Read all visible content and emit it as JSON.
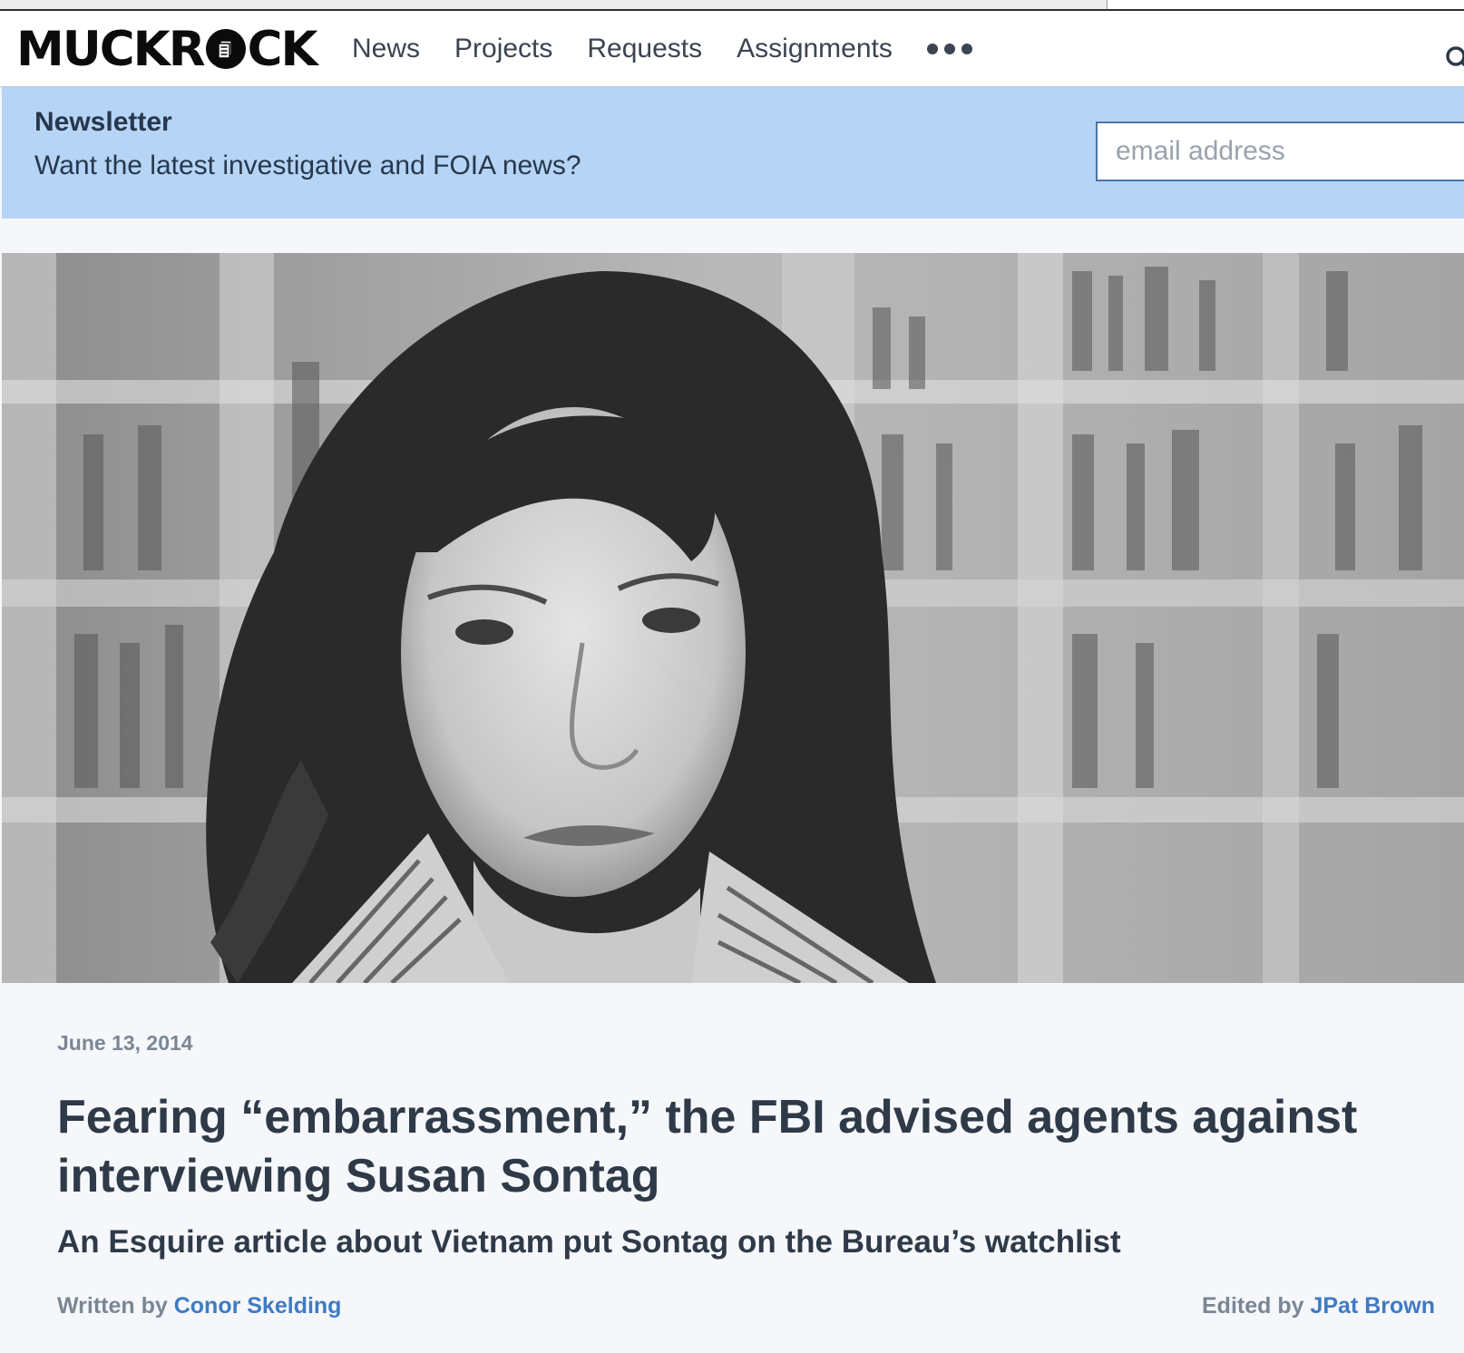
{
  "header": {
    "logo_text_left": "MUCKR",
    "logo_text_right": "CK",
    "nav": [
      "News",
      "Projects",
      "Requests",
      "Assignments"
    ],
    "more_icon": "ellipsis-icon",
    "search_icon": "search-icon"
  },
  "newsletter": {
    "title": "Newsletter",
    "description": "Want the latest investigative and FOIA news?",
    "email_placeholder": "email address"
  },
  "article": {
    "date": "June 13, 2014",
    "headline": "Fearing “embarrassment,” the FBI advised agents against interviewing Susan Sontag",
    "subhead": "An Esquire article about Vietnam put Sontag on the Bureau’s watchlist",
    "written_by_prefix": "Written by",
    "author": "Conor Skelding",
    "edited_by_prefix": "Edited by",
    "editor": "JPat Brown"
  },
  "colors": {
    "newsletter_bg": "#b6d4f6",
    "link": "#3f7bc3",
    "text": "#2f3a48",
    "muted": "#7b8694"
  }
}
